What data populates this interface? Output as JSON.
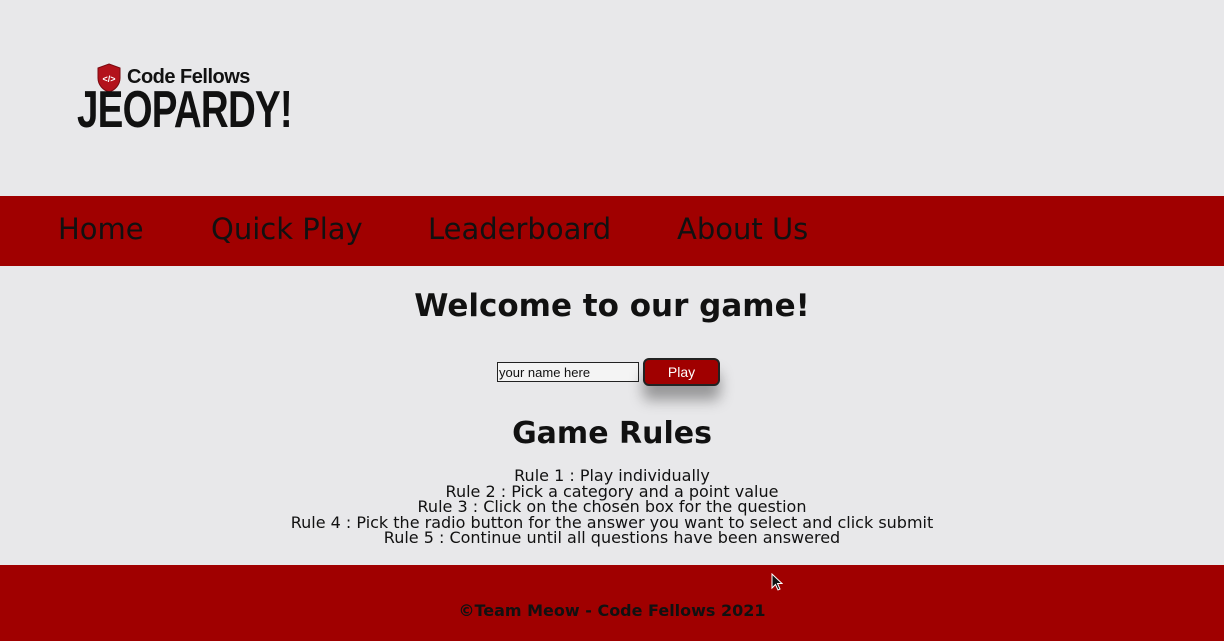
{
  "logo": {
    "small_text": "Code Fellows",
    "big_text": "JEOPARDY!",
    "shield_text": "</>"
  },
  "nav": {
    "items": [
      {
        "label": "Home"
      },
      {
        "label": "Quick Play"
      },
      {
        "label": "Leaderboard"
      },
      {
        "label": "About Us"
      }
    ]
  },
  "main": {
    "welcome": "Welcome to our game!",
    "name_input": {
      "value": "your name here"
    },
    "play_label": "Play",
    "rules_title": "Game Rules",
    "rules": [
      "Rule 1 : Play individually",
      "Rule 2 : Pick a category and a point value",
      "Rule 3 : Click on the chosen box for the question",
      "Rule 4 : Pick the radio button for the answer you want to select and click submit",
      "Rule 5 : Continue until all questions have been answered"
    ]
  },
  "footer": {
    "text": "©Team Meow - Code Fellows 2021"
  },
  "colors": {
    "brand_red": "#a00000",
    "background": "#e8e8ea"
  }
}
